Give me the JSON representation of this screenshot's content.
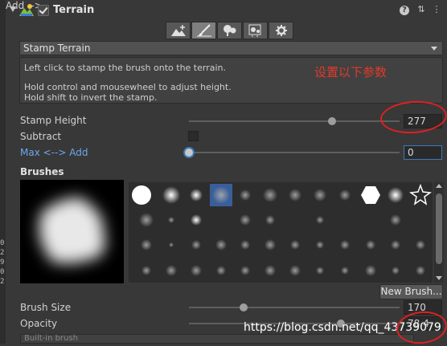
{
  "left_strip": [
    "0",
    "2",
    "9",
    "0",
    "2"
  ],
  "header": {
    "title": "Terrain",
    "enabled": true,
    "help": "?",
    "settings": "⇅",
    "menu": "⋮"
  },
  "tools": [
    {
      "name": "raise-terrain-icon",
      "active": false
    },
    {
      "name": "paint-brush-icon",
      "active": true
    },
    {
      "name": "tree-icon",
      "active": false
    },
    {
      "name": "details-icon",
      "active": false
    },
    {
      "name": "gear-icon",
      "active": false
    }
  ],
  "mode_dropdown": {
    "value": "Stamp Terrain"
  },
  "help_box": {
    "line1": "Left click to stamp the brush onto the terrain.",
    "line2": "Hold control and mousewheel to adjust height.",
    "line3": "Hold shift to invert the stamp."
  },
  "annotation": "设置以下参数",
  "stamp_height": {
    "label": "Stamp Height",
    "value": "277",
    "fraction": 0.68
  },
  "subtract": {
    "label": "Subtract",
    "checked": false
  },
  "max_add": {
    "label": "Max <--> Add",
    "value": "0",
    "fraction": 0.0
  },
  "brushes": {
    "label": "Brushes"
  },
  "new_brush_label": "New Brush...",
  "brush_size": {
    "label": "Brush Size",
    "value": "170",
    "fraction": 0.26
  },
  "opacity": {
    "label": "Opacity",
    "value": "78.4",
    "fraction": 0.72
  },
  "built_in_label": "Built-in brush",
  "watermark": "https://blog.csdn.net/qq_43739079",
  "colors": {
    "accent": "#3a79bb",
    "annotation": "#e23a2a",
    "label_blue": "#6aa8ef"
  }
}
